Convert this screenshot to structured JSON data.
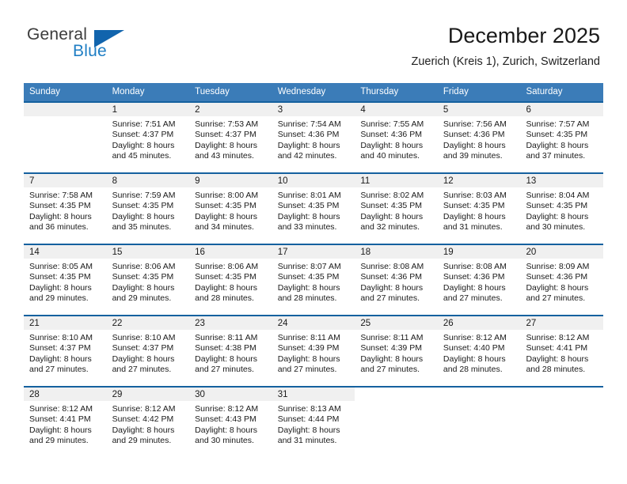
{
  "logo": {
    "line1": "General",
    "line2": "Blue",
    "triangle_color": "#1164ad",
    "blue_text_color": "#1f7ec4"
  },
  "header": {
    "title": "December 2025",
    "subtitle": "Zuerich (Kreis 1), Zurich, Switzerland"
  },
  "theme": {
    "header_row_bg": "#3b7cb8",
    "row_divider": "#15619f",
    "daynum_band_bg": "#f0f0f0"
  },
  "calendar": {
    "weekday_headers": [
      "Sunday",
      "Monday",
      "Tuesday",
      "Wednesday",
      "Thursday",
      "Friday",
      "Saturday"
    ],
    "weeks": [
      [
        {
          "day": "",
          "blank": true,
          "empty_band": true,
          "sunrise": "",
          "sunset": "",
          "daylight1": "",
          "daylight2": ""
        },
        {
          "day": "1",
          "sunrise": "Sunrise: 7:51 AM",
          "sunset": "Sunset: 4:37 PM",
          "daylight1": "Daylight: 8 hours",
          "daylight2": "and 45 minutes."
        },
        {
          "day": "2",
          "sunrise": "Sunrise: 7:53 AM",
          "sunset": "Sunset: 4:37 PM",
          "daylight1": "Daylight: 8 hours",
          "daylight2": "and 43 minutes."
        },
        {
          "day": "3",
          "sunrise": "Sunrise: 7:54 AM",
          "sunset": "Sunset: 4:36 PM",
          "daylight1": "Daylight: 8 hours",
          "daylight2": "and 42 minutes."
        },
        {
          "day": "4",
          "sunrise": "Sunrise: 7:55 AM",
          "sunset": "Sunset: 4:36 PM",
          "daylight1": "Daylight: 8 hours",
          "daylight2": "and 40 minutes."
        },
        {
          "day": "5",
          "sunrise": "Sunrise: 7:56 AM",
          "sunset": "Sunset: 4:36 PM",
          "daylight1": "Daylight: 8 hours",
          "daylight2": "and 39 minutes."
        },
        {
          "day": "6",
          "sunrise": "Sunrise: 7:57 AM",
          "sunset": "Sunset: 4:35 PM",
          "daylight1": "Daylight: 8 hours",
          "daylight2": "and 37 minutes."
        }
      ],
      [
        {
          "day": "7",
          "sunrise": "Sunrise: 7:58 AM",
          "sunset": "Sunset: 4:35 PM",
          "daylight1": "Daylight: 8 hours",
          "daylight2": "and 36 minutes."
        },
        {
          "day": "8",
          "sunrise": "Sunrise: 7:59 AM",
          "sunset": "Sunset: 4:35 PM",
          "daylight1": "Daylight: 8 hours",
          "daylight2": "and 35 minutes."
        },
        {
          "day": "9",
          "sunrise": "Sunrise: 8:00 AM",
          "sunset": "Sunset: 4:35 PM",
          "daylight1": "Daylight: 8 hours",
          "daylight2": "and 34 minutes."
        },
        {
          "day": "10",
          "sunrise": "Sunrise: 8:01 AM",
          "sunset": "Sunset: 4:35 PM",
          "daylight1": "Daylight: 8 hours",
          "daylight2": "and 33 minutes."
        },
        {
          "day": "11",
          "sunrise": "Sunrise: 8:02 AM",
          "sunset": "Sunset: 4:35 PM",
          "daylight1": "Daylight: 8 hours",
          "daylight2": "and 32 minutes."
        },
        {
          "day": "12",
          "sunrise": "Sunrise: 8:03 AM",
          "sunset": "Sunset: 4:35 PM",
          "daylight1": "Daylight: 8 hours",
          "daylight2": "and 31 minutes."
        },
        {
          "day": "13",
          "sunrise": "Sunrise: 8:04 AM",
          "sunset": "Sunset: 4:35 PM",
          "daylight1": "Daylight: 8 hours",
          "daylight2": "and 30 minutes."
        }
      ],
      [
        {
          "day": "14",
          "sunrise": "Sunrise: 8:05 AM",
          "sunset": "Sunset: 4:35 PM",
          "daylight1": "Daylight: 8 hours",
          "daylight2": "and 29 minutes."
        },
        {
          "day": "15",
          "sunrise": "Sunrise: 8:06 AM",
          "sunset": "Sunset: 4:35 PM",
          "daylight1": "Daylight: 8 hours",
          "daylight2": "and 29 minutes."
        },
        {
          "day": "16",
          "sunrise": "Sunrise: 8:06 AM",
          "sunset": "Sunset: 4:35 PM",
          "daylight1": "Daylight: 8 hours",
          "daylight2": "and 28 minutes."
        },
        {
          "day": "17",
          "sunrise": "Sunrise: 8:07 AM",
          "sunset": "Sunset: 4:35 PM",
          "daylight1": "Daylight: 8 hours",
          "daylight2": "and 28 minutes."
        },
        {
          "day": "18",
          "sunrise": "Sunrise: 8:08 AM",
          "sunset": "Sunset: 4:36 PM",
          "daylight1": "Daylight: 8 hours",
          "daylight2": "and 27 minutes."
        },
        {
          "day": "19",
          "sunrise": "Sunrise: 8:08 AM",
          "sunset": "Sunset: 4:36 PM",
          "daylight1": "Daylight: 8 hours",
          "daylight2": "and 27 minutes."
        },
        {
          "day": "20",
          "sunrise": "Sunrise: 8:09 AM",
          "sunset": "Sunset: 4:36 PM",
          "daylight1": "Daylight: 8 hours",
          "daylight2": "and 27 minutes."
        }
      ],
      [
        {
          "day": "21",
          "sunrise": "Sunrise: 8:10 AM",
          "sunset": "Sunset: 4:37 PM",
          "daylight1": "Daylight: 8 hours",
          "daylight2": "and 27 minutes."
        },
        {
          "day": "22",
          "sunrise": "Sunrise: 8:10 AM",
          "sunset": "Sunset: 4:37 PM",
          "daylight1": "Daylight: 8 hours",
          "daylight2": "and 27 minutes."
        },
        {
          "day": "23",
          "sunrise": "Sunrise: 8:11 AM",
          "sunset": "Sunset: 4:38 PM",
          "daylight1": "Daylight: 8 hours",
          "daylight2": "and 27 minutes."
        },
        {
          "day": "24",
          "sunrise": "Sunrise: 8:11 AM",
          "sunset": "Sunset: 4:39 PM",
          "daylight1": "Daylight: 8 hours",
          "daylight2": "and 27 minutes."
        },
        {
          "day": "25",
          "sunrise": "Sunrise: 8:11 AM",
          "sunset": "Sunset: 4:39 PM",
          "daylight1": "Daylight: 8 hours",
          "daylight2": "and 27 minutes."
        },
        {
          "day": "26",
          "sunrise": "Sunrise: 8:12 AM",
          "sunset": "Sunset: 4:40 PM",
          "daylight1": "Daylight: 8 hours",
          "daylight2": "and 28 minutes."
        },
        {
          "day": "27",
          "sunrise": "Sunrise: 8:12 AM",
          "sunset": "Sunset: 4:41 PM",
          "daylight1": "Daylight: 8 hours",
          "daylight2": "and 28 minutes."
        }
      ],
      [
        {
          "day": "28",
          "sunrise": "Sunrise: 8:12 AM",
          "sunset": "Sunset: 4:41 PM",
          "daylight1": "Daylight: 8 hours",
          "daylight2": "and 29 minutes."
        },
        {
          "day": "29",
          "sunrise": "Sunrise: 8:12 AM",
          "sunset": "Sunset: 4:42 PM",
          "daylight1": "Daylight: 8 hours",
          "daylight2": "and 29 minutes."
        },
        {
          "day": "30",
          "sunrise": "Sunrise: 8:12 AM",
          "sunset": "Sunset: 4:43 PM",
          "daylight1": "Daylight: 8 hours",
          "daylight2": "and 30 minutes."
        },
        {
          "day": "31",
          "sunrise": "Sunrise: 8:13 AM",
          "sunset": "Sunset: 4:44 PM",
          "daylight1": "Daylight: 8 hours",
          "daylight2": "and 31 minutes."
        },
        {
          "day": "",
          "blank": true,
          "sunrise": "",
          "sunset": "",
          "daylight1": "",
          "daylight2": ""
        },
        {
          "day": "",
          "blank": true,
          "sunrise": "",
          "sunset": "",
          "daylight1": "",
          "daylight2": ""
        },
        {
          "day": "",
          "blank": true,
          "sunrise": "",
          "sunset": "",
          "daylight1": "",
          "daylight2": ""
        }
      ]
    ]
  }
}
